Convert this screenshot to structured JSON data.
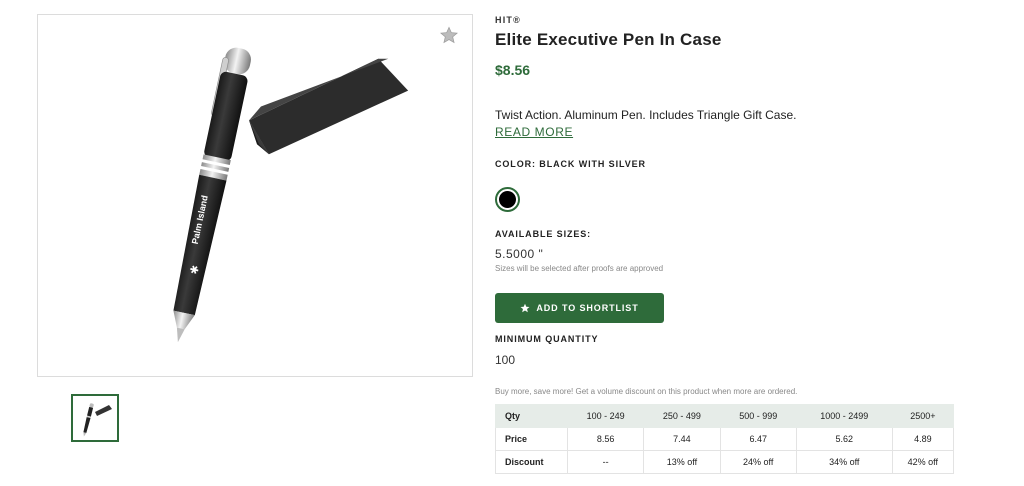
{
  "product": {
    "brand": "HIT®",
    "title": "Elite Executive Pen In Case",
    "price": "$8.56",
    "description": "Twist Action. Aluminum Pen. Includes Triangle Gift Case.",
    "read_more": "READ MORE",
    "color_label": "COLOR: BLACK WITH SILVER",
    "color_swatch": "#000000",
    "sizes_label": "AVAILABLE SIZES:",
    "size_value": "5.5000 \"",
    "size_note": "Sizes will be selected after proofs are approved",
    "add_button": "ADD TO SHORTLIST",
    "min_qty_label": "MINIMUM QUANTITY",
    "min_qty_value": "100",
    "volume_note": "Buy more, save more! Get a volume discount on this product when more are ordered.",
    "imprint_text": "Palm Island"
  },
  "pricing": {
    "header": [
      "Qty",
      "100 - 249",
      "250 - 499",
      "500 - 999",
      "1000 - 2499",
      "2500+"
    ],
    "rows": [
      [
        "Price",
        "8.56",
        "7.44",
        "6.47",
        "5.62",
        "4.89"
      ],
      [
        "Discount",
        "--",
        "13% off",
        "24% off",
        "34% off",
        "42% off"
      ]
    ]
  },
  "colors": {
    "accent": "#2e6b3a",
    "table_header": "#e6ece8"
  },
  "icons": {
    "favorite": "star-icon",
    "add": "star-icon"
  }
}
